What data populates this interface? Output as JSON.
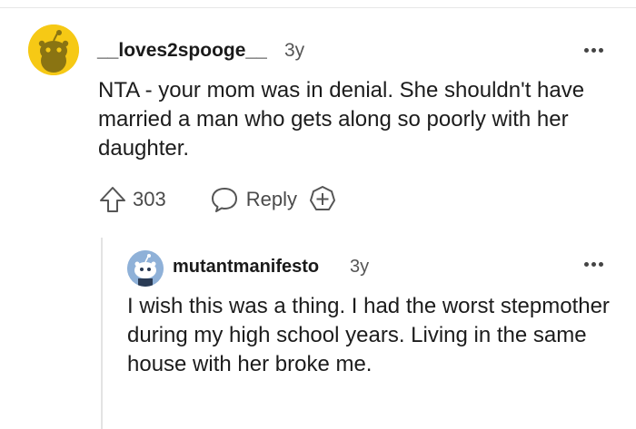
{
  "comments": [
    {
      "username": "__loves2spooge__",
      "age": "3y",
      "body": "NTA - your mom was in denial. She shouldn't have married a man who gets along so poorly with her daughter.",
      "votes": "303",
      "reply_label": "Reply",
      "avatar_color": "#f6c915"
    },
    {
      "username": "mutantmanifesto",
      "age": "3y",
      "body": "I wish this was a thing. I had the worst stepmother during my high school years. Living in the same house with her broke me.",
      "avatar_color": "#8fb1d8"
    }
  ],
  "icons": {
    "upvote": "arrow-up-icon",
    "reply": "speech-bubble-icon",
    "award": "add-award-icon",
    "more": "ellipsis-icon"
  }
}
